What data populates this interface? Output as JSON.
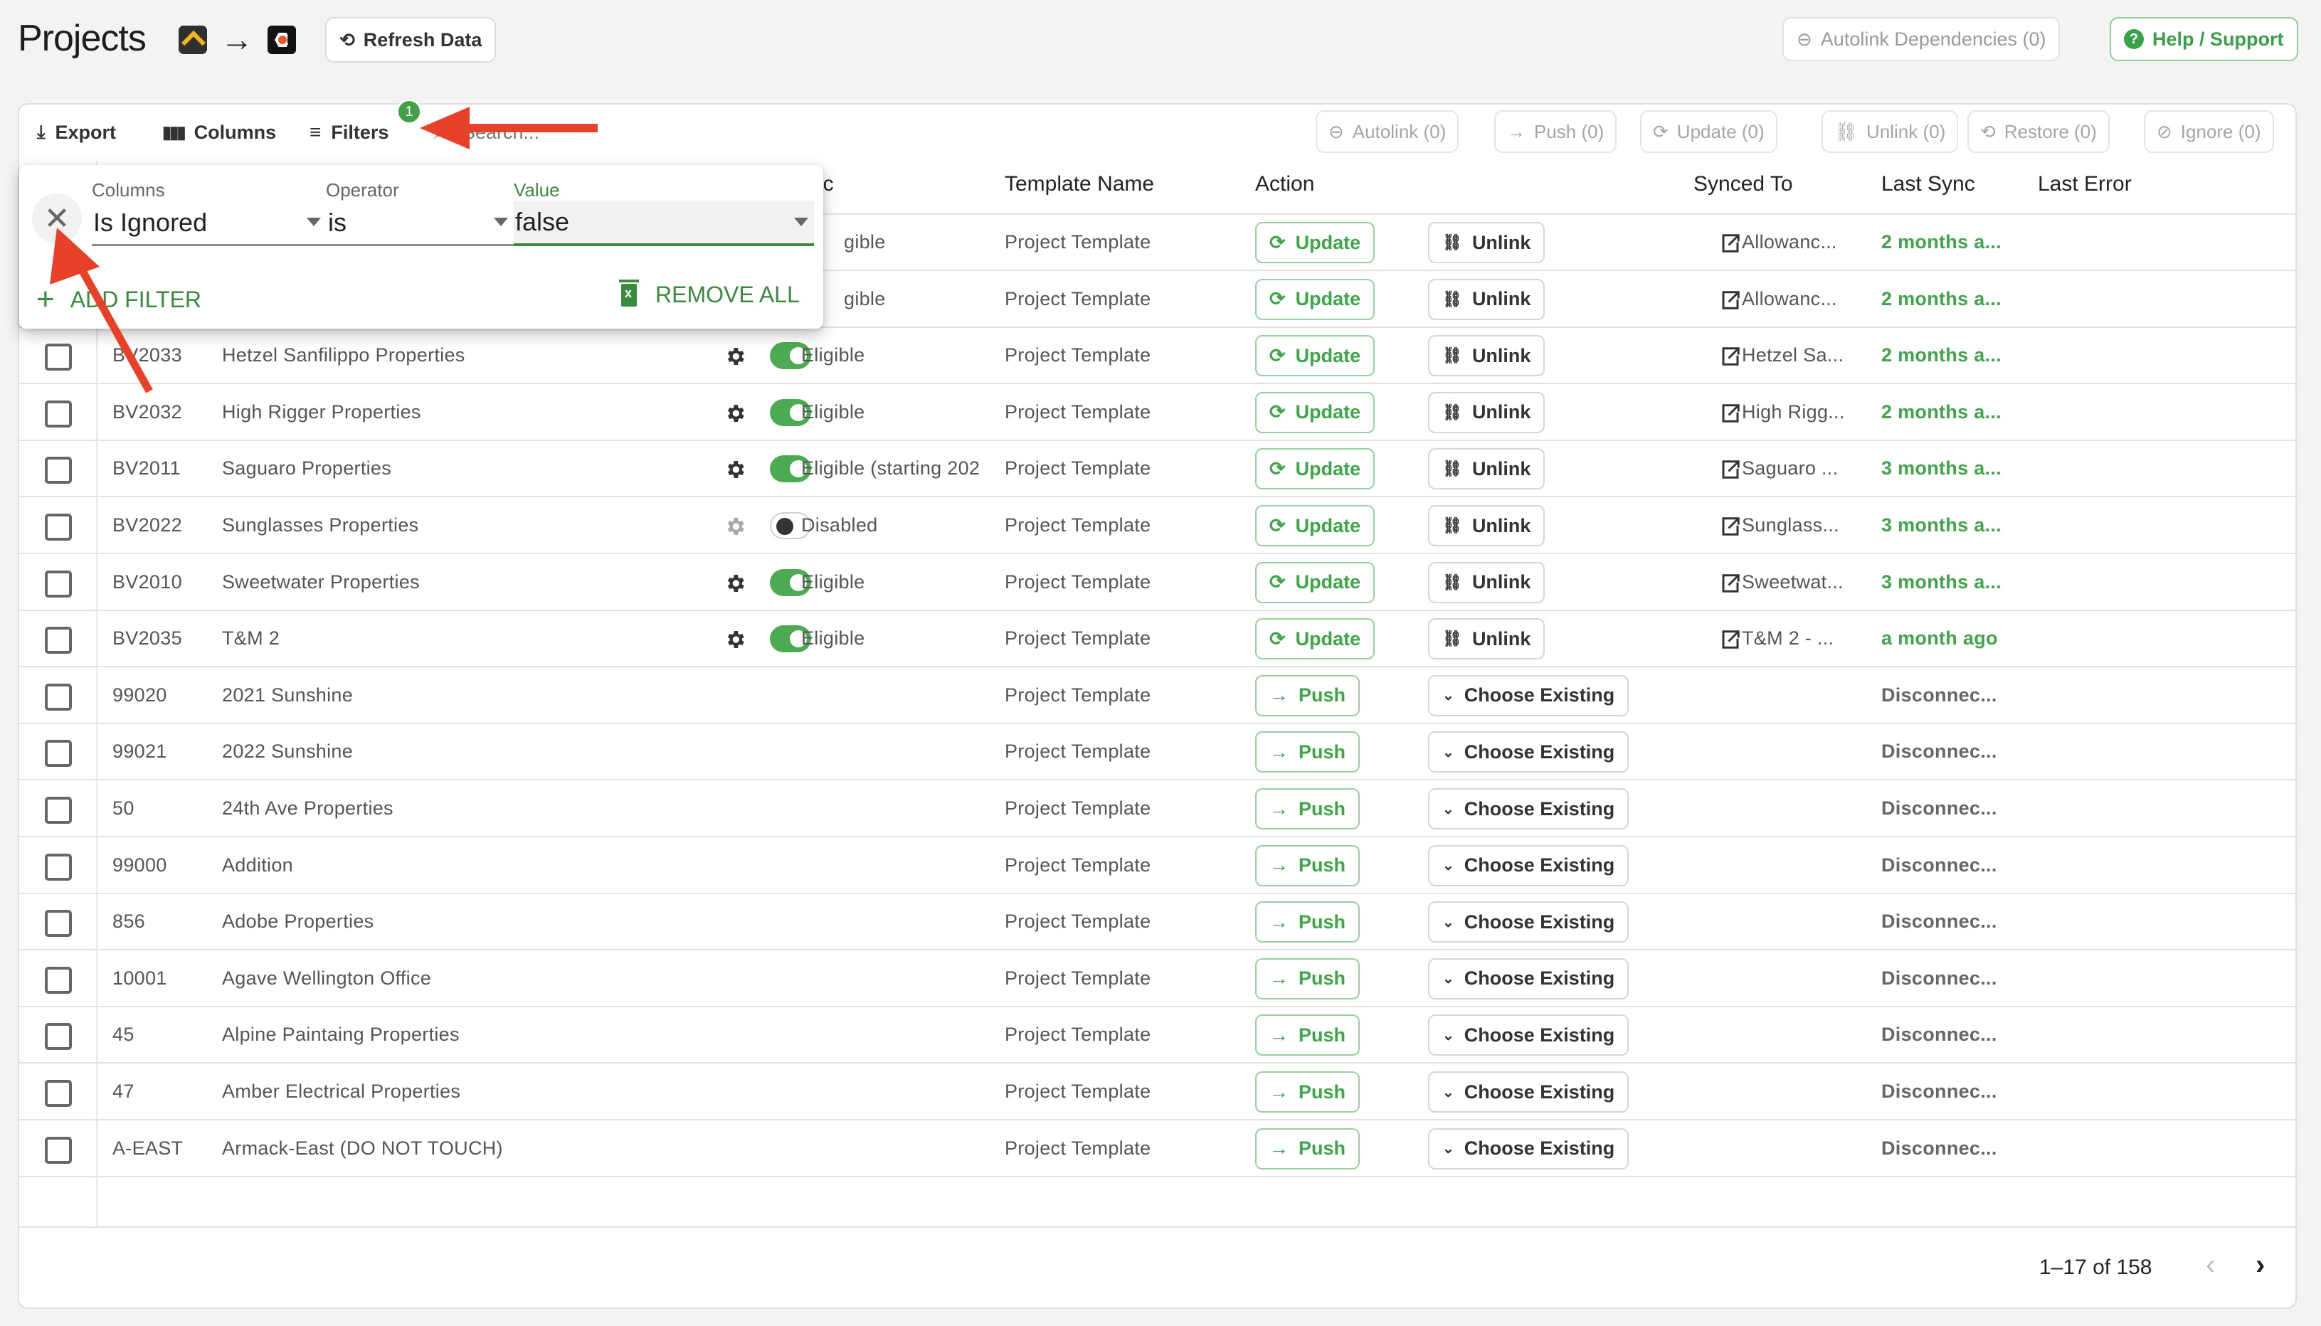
{
  "header": {
    "title": "Projects",
    "source_icon": "source-app-logo",
    "target_icon": "target-app-logo",
    "refresh_label": "Refresh Data",
    "autolink_dependencies_label": "Autolink Dependencies (0)",
    "help_label": "Help / Support"
  },
  "toolbar": {
    "export_label": "Export",
    "columns_label": "Columns",
    "filters_label": "Filters",
    "filters_count": "1",
    "search_placeholder": "Search...",
    "bulk_actions": [
      {
        "label": "Autolink (0)",
        "icon": "link-icon"
      },
      {
        "label": "Push (0)",
        "icon": "arrow-right-icon"
      },
      {
        "label": "Update (0)",
        "icon": "sync-icon"
      },
      {
        "label": "Unlink (0)",
        "icon": "unlink-icon"
      },
      {
        "label": "Restore (0)",
        "icon": "restore-icon"
      },
      {
        "label": "Ignore (0)",
        "icon": "eye-off-icon"
      }
    ]
  },
  "filter_panel": {
    "columns_label": "Columns",
    "operator_label": "Operator",
    "value_label": "Value",
    "column_value": "Is Ignored",
    "operator_value": "is",
    "value_value": "false",
    "add_filter_label": "ADD FILTER",
    "remove_all_label": "REMOVE ALL"
  },
  "table": {
    "columns": {
      "sync": "nc",
      "template_name": "Template Name",
      "action": "Action",
      "synced_to": "Synced To",
      "last_sync": "Last Sync",
      "last_error": "Last Error"
    },
    "rows": [
      {
        "code": "",
        "name": "",
        "sync_enabled": true,
        "eligibility": "gible",
        "template": "Project Template",
        "action": "Update",
        "secondary": "Unlink",
        "synced_to": "Allowanc...",
        "last_sync": "2 months a...",
        "linked": true,
        "partial": true
      },
      {
        "code": "",
        "name": "",
        "sync_enabled": true,
        "eligibility": "gible",
        "template": "Project Template",
        "action": "Update",
        "secondary": "Unlink",
        "synced_to": "Allowanc...",
        "last_sync": "2 months a...",
        "linked": true,
        "partial": true
      },
      {
        "code": "BV2033",
        "name": "Hetzel Sanfilippo Properties",
        "sync_enabled": true,
        "eligibility": "Eligible",
        "template": "Project Template",
        "action": "Update",
        "secondary": "Unlink",
        "synced_to": "Hetzel Sa...",
        "last_sync": "2 months a...",
        "linked": true
      },
      {
        "code": "BV2032",
        "name": "High Rigger Properties",
        "sync_enabled": true,
        "eligibility": "Eligible",
        "template": "Project Template",
        "action": "Update",
        "secondary": "Unlink",
        "synced_to": "High Rigg...",
        "last_sync": "2 months a...",
        "linked": true
      },
      {
        "code": "BV2011",
        "name": "Saguaro Properties",
        "sync_enabled": true,
        "eligibility": "Eligible (starting 202",
        "template": "Project Template",
        "action": "Update",
        "secondary": "Unlink",
        "synced_to": "Saguaro ...",
        "last_sync": "3 months a...",
        "linked": true
      },
      {
        "code": "BV2022",
        "name": "Sunglasses Properties",
        "sync_enabled": false,
        "eligibility": "Disabled",
        "template": "Project Template",
        "action": "Update",
        "secondary": "Unlink",
        "synced_to": "Sunglass...",
        "last_sync": "3 months a...",
        "linked": true
      },
      {
        "code": "BV2010",
        "name": "Sweetwater Properties",
        "sync_enabled": true,
        "eligibility": "Eligible",
        "template": "Project Template",
        "action": "Update",
        "secondary": "Unlink",
        "synced_to": "Sweetwat...",
        "last_sync": "3 months a...",
        "linked": true
      },
      {
        "code": "BV2035",
        "name": "T&M 2",
        "sync_enabled": true,
        "eligibility": "Eligible",
        "template": "Project Template",
        "action": "Update",
        "secondary": "Unlink",
        "synced_to": "T&M 2 - ...",
        "last_sync": "a month ago",
        "linked": true
      },
      {
        "code": "99020",
        "name": "2021 Sunshine",
        "template": "Project Template",
        "action": "Push",
        "secondary": "Choose Existing",
        "last_sync": "Disconnec...",
        "linked": false
      },
      {
        "code": "99021",
        "name": "2022 Sunshine",
        "template": "Project Template",
        "action": "Push",
        "secondary": "Choose Existing",
        "last_sync": "Disconnec...",
        "linked": false
      },
      {
        "code": "50",
        "name": "24th Ave Properties",
        "template": "Project Template",
        "action": "Push",
        "secondary": "Choose Existing",
        "last_sync": "Disconnec...",
        "linked": false
      },
      {
        "code": "99000",
        "name": "Addition",
        "template": "Project Template",
        "action": "Push",
        "secondary": "Choose Existing",
        "last_sync": "Disconnec...",
        "linked": false
      },
      {
        "code": "856",
        "name": "Adobe Properties",
        "template": "Project Template",
        "action": "Push",
        "secondary": "Choose Existing",
        "last_sync": "Disconnec...",
        "linked": false
      },
      {
        "code": "10001",
        "name": "Agave Wellington Office",
        "template": "Project Template",
        "action": "Push",
        "secondary": "Choose Existing",
        "last_sync": "Disconnec...",
        "linked": false
      },
      {
        "code": "45",
        "name": "Alpine Paintaing Properties",
        "template": "Project Template",
        "action": "Push",
        "secondary": "Choose Existing",
        "last_sync": "Disconnec...",
        "linked": false
      },
      {
        "code": "47",
        "name": "Amber Electrical Properties",
        "template": "Project Template",
        "action": "Push",
        "secondary": "Choose Existing",
        "last_sync": "Disconnec...",
        "linked": false
      },
      {
        "code": "A-EAST",
        "name": "Armack-East (DO NOT TOUCH)",
        "template": "Project Template",
        "action": "Push",
        "secondary": "Choose Existing",
        "last_sync": "Disconnec...",
        "linked": false
      }
    ]
  },
  "pagination": {
    "range_text": "1–17 of 158"
  },
  "colors": {
    "accent_green": "#43a047",
    "annotation_red": "#e8412a"
  }
}
